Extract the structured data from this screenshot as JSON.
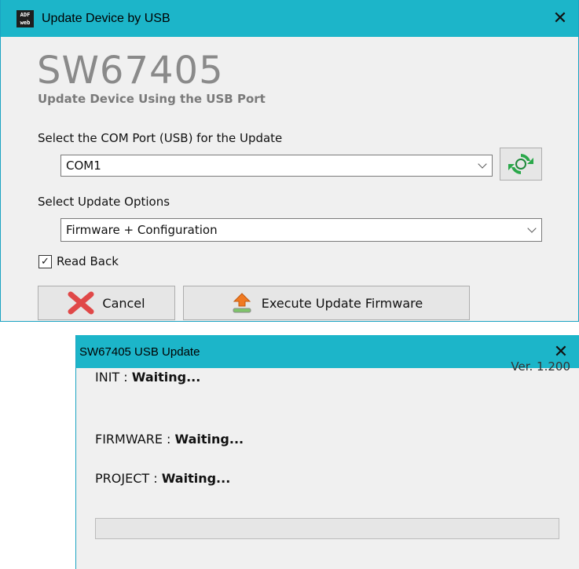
{
  "window1": {
    "title": "Update Device by USB",
    "icon_text": [
      "ADF",
      "web"
    ],
    "close_glyph": "✕",
    "heading": "SW67405",
    "subheading": "Update Device Using the USB Port",
    "com_label": "Select the COM Port (USB) for the Update",
    "com_value": "COM1",
    "options_label": "Select Update Options",
    "options_value": "Firmware + Configuration",
    "readback_label": "Read Back",
    "readback_checked": true,
    "cancel_label": "Cancel",
    "execute_label": "Execute Update Firmware",
    "refresh_icon": "refresh-icon"
  },
  "window2": {
    "title": "SW67405 USB Update",
    "close_glyph": "✕",
    "version": "Ver. 1.200",
    "init_label": "INIT : ",
    "init_status": "Waiting...",
    "firmware_label": "FIRMWARE : ",
    "firmware_status": "Waiting...",
    "project_label": "PROJECT : ",
    "project_status": "Waiting...",
    "progress": 0
  },
  "colors": {
    "titlebar": "#1cb5c9",
    "border": "#1aa3c2",
    "window_bg": "#f0f0f0",
    "cancel_x": "#e04848",
    "refresh_green": "#2aa84a",
    "upload_orange": "#f07a22"
  }
}
